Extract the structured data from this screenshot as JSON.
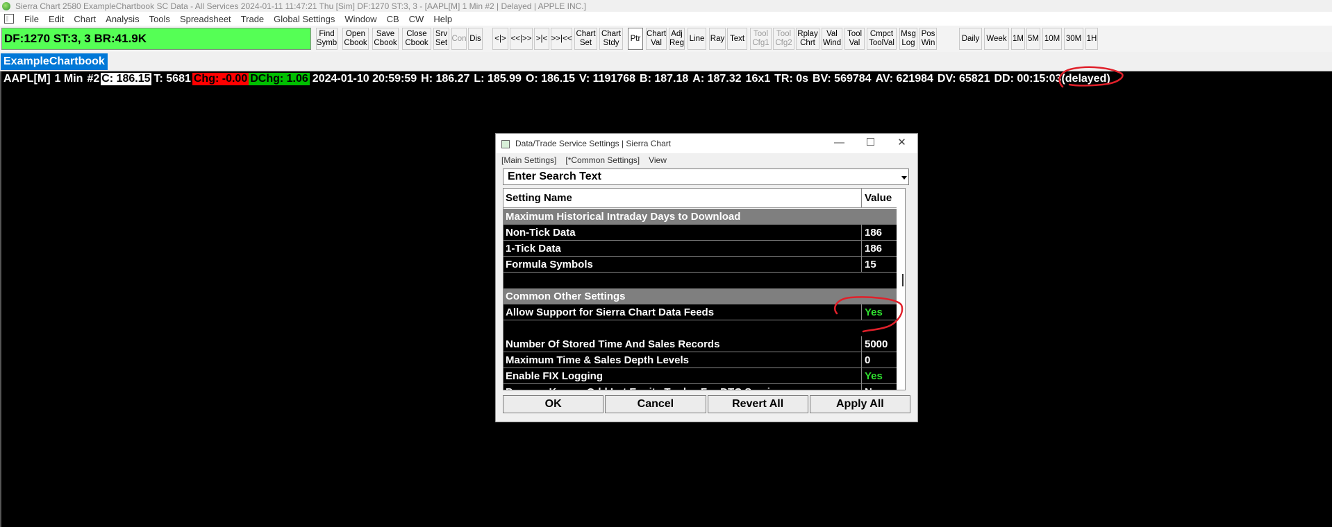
{
  "window": {
    "title": "Sierra Chart 2580 ExampleChartbook SC Data - All Services 2024-01-11  11:47:21 Thu [Sim]  DF:1270  ST:3, 3 - [AAPL[M]  1 Min  #2 | Delayed | APPLE INC.]"
  },
  "menu": [
    "File",
    "Edit",
    "Chart",
    "Analysis",
    "Tools",
    "Spreadsheet",
    "Trade",
    "Global Settings",
    "Window",
    "CB",
    "CW",
    "Help"
  ],
  "status_box": {
    "text": "DF:1270  ST:3, 3  BR:41.9K",
    "color": "#55ff55"
  },
  "toolbar": {
    "buttons": [
      {
        "label": "Find\nSymb",
        "state": "normal"
      },
      {
        "label": "Open\nCbook",
        "state": "normal"
      },
      {
        "label": "Save\nCbook",
        "state": "normal"
      },
      {
        "label": "Close\nCbook",
        "state": "normal"
      },
      {
        "label": "Srv\nSet",
        "state": "normal"
      },
      {
        "label": "Con",
        "state": "disabled"
      },
      {
        "label": "Dis",
        "state": "normal"
      },
      {
        "label": "<|>",
        "state": "normal"
      },
      {
        "label": "<<|>>",
        "state": "normal"
      },
      {
        "label": ">|<",
        "state": "normal"
      },
      {
        "label": ">>|<<",
        "state": "normal"
      },
      {
        "label": "Chart\nSet",
        "state": "normal"
      },
      {
        "label": "Chart\nStdy",
        "state": "normal"
      },
      {
        "label": "Ptr",
        "state": "pressed"
      },
      {
        "label": "Chart\nVal",
        "state": "normal"
      },
      {
        "label": "Adj\nReg",
        "state": "normal"
      },
      {
        "label": "Line",
        "state": "normal"
      },
      {
        "label": "Ray",
        "state": "normal"
      },
      {
        "label": "Text",
        "state": "normal"
      },
      {
        "label": "Tool\nCfg1",
        "state": "disabled"
      },
      {
        "label": "Tool\nCfg2",
        "state": "disabled"
      },
      {
        "label": "Rplay\nChrt",
        "state": "normal"
      },
      {
        "label": "Val\nWind",
        "state": "normal"
      },
      {
        "label": "Tool\nVal",
        "state": "normal"
      },
      {
        "label": "Cmpct\nToolVal",
        "state": "normal"
      },
      {
        "label": "Msg\nLog",
        "state": "normal"
      },
      {
        "label": "Pos\nWin",
        "state": "normal"
      },
      {
        "label": "Daily",
        "state": "normal"
      },
      {
        "label": "Week",
        "state": "normal"
      },
      {
        "label": "1M",
        "state": "normal"
      },
      {
        "label": "5M",
        "state": "normal"
      },
      {
        "label": "10M",
        "state": "normal"
      },
      {
        "label": "30M",
        "state": "normal"
      },
      {
        "label": "1H",
        "state": "normal"
      }
    ]
  },
  "chartbook_tab": "ExampleChartbook",
  "chart_header": {
    "symbol": "AAPL[M]",
    "interval": "1 Min",
    "chart_num": "#2",
    "close": "C: 186.15",
    "trades": "T: 5681",
    "change": "Chg: -0.00",
    "daily_change": "DChg: 1.06",
    "datetime": "2024-01-10 20:59:59",
    "high": "H: 186.27",
    "low": "L: 185.99",
    "open": "O: 186.15",
    "volume": "V: 1191768",
    "bid": "B: 187.18",
    "ask": "A: 187.32",
    "size": "16x1",
    "tr": "TR: 0s",
    "bid_volume": "BV: 569784",
    "ask_volume": "AV: 621984",
    "delta_volume": "DV: 65821",
    "data_delay": "DD: 00:15:03",
    "delayed": "(delayed)"
  },
  "dialog": {
    "title": "Data/Trade Service Settings | Sierra Chart",
    "tabs": [
      "[Main Settings]",
      "[*Common Settings]",
      "View"
    ],
    "search_placeholder": "Enter Search Text",
    "columns": [
      "Setting Name",
      "Value"
    ],
    "rows": [
      {
        "kind": "section",
        "name": "Maximum Historical Intraday Days to Download",
        "value": ""
      },
      {
        "kind": "data",
        "name": "Non-Tick Data",
        "value": "186"
      },
      {
        "kind": "data",
        "name": "1-Tick Data",
        "value": "186"
      },
      {
        "kind": "data",
        "name": "Formula Symbols",
        "value": "15"
      },
      {
        "kind": "blank",
        "name": "",
        "value": ""
      },
      {
        "kind": "section",
        "name": "Common Other Settings",
        "value": ""
      },
      {
        "kind": "data",
        "name": "Allow Support for Sierra Chart Data Feeds",
        "value": "Yes",
        "value_color": "#2fe02f"
      },
      {
        "kind": "blank",
        "name": "",
        "value": ""
      },
      {
        "kind": "data",
        "name": "Number Of Stored Time And Sales Records",
        "value": "5000"
      },
      {
        "kind": "data",
        "name": "Maximum Time & Sales Depth Levels",
        "value": "0"
      },
      {
        "kind": "data",
        "name": "Enable FIX Logging",
        "value": "Yes",
        "value_color": "#2fe02f"
      },
      {
        "kind": "data",
        "name": "Process Known Odd Lot Equity Trades For DTC Services",
        "value": "No"
      }
    ],
    "buttons": [
      "OK",
      "Cancel",
      "Revert All",
      "Apply All"
    ]
  },
  "annotation_color": "#e0202a"
}
